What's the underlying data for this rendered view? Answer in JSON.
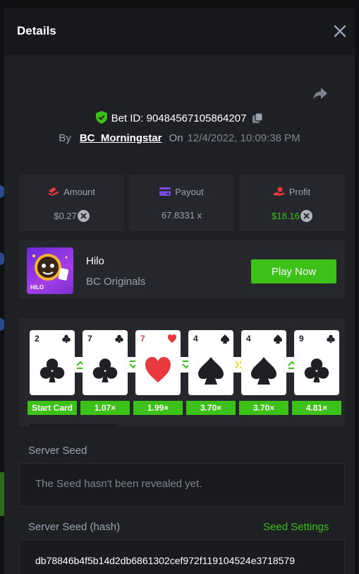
{
  "header": {
    "title": "Details"
  },
  "bet": {
    "bet_id_label": "Bet ID: 90484567105864207",
    "by_label": "By",
    "username": "BC_Morningstar",
    "on_label": "On",
    "datetime": "12/4/2022, 10:09:38 PM"
  },
  "stats": {
    "amount": {
      "label": "Amount",
      "value": "$0.27"
    },
    "payout": {
      "label": "Payout",
      "value": "67.8331 x"
    },
    "profit": {
      "label": "Profit",
      "value": "$18.16"
    }
  },
  "game": {
    "name": "Hilo",
    "provider": "BC Originals",
    "thumb_text": "HILO",
    "play_label": "Play Now"
  },
  "cards": [
    {
      "rank": "2",
      "suit": "club",
      "multiplier": "Start Card",
      "next_arrow": "up"
    },
    {
      "rank": "7",
      "suit": "club",
      "multiplier": "1.07×",
      "next_arrow": "down"
    },
    {
      "rank": "7",
      "suit": "heart",
      "multiplier": "1.99×",
      "next_arrow": "down"
    },
    {
      "rank": "4",
      "suit": "spade",
      "multiplier": "3.70×",
      "next_arrow": "skip"
    },
    {
      "rank": "4",
      "suit": "spade",
      "multiplier": "3.70×",
      "next_arrow": "up"
    },
    {
      "rank": "9",
      "suit": "club",
      "multiplier": "4.81×",
      "next_arrow": ""
    }
  ],
  "seeds": {
    "server_seed_label": "Server Seed",
    "server_seed_msg": "The Seed hasn't been revealed yet.",
    "server_hash_label": "Server Seed (hash)",
    "seed_settings_label": "Seed Settings",
    "server_hash_value": "db78846b4f5b14d2db6861302cef972f119104524e3718579"
  },
  "colors": {
    "accent_green": "#3bc117",
    "panel": "#25272c",
    "background": "#1e2024",
    "muted_text": "#99a4b0"
  },
  "icons": [
    "close-icon",
    "share-icon",
    "shield-check-icon",
    "copy-icon",
    "amount-icon",
    "payout-icon",
    "profit-icon",
    "coin-icon"
  ]
}
